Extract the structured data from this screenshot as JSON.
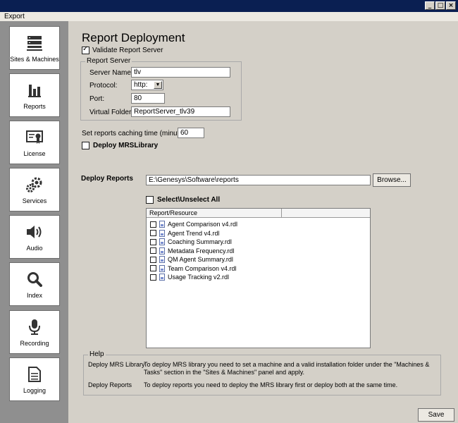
{
  "window": {
    "minimize": "_",
    "maximize": "□",
    "close": "×"
  },
  "menu": {
    "export": "Export"
  },
  "sidebar": {
    "items": [
      {
        "label": "Sites & Machines",
        "icon": "server-icon"
      },
      {
        "label": "Reports",
        "icon": "bar-chart-icon"
      },
      {
        "label": "License",
        "icon": "certificate-icon"
      },
      {
        "label": "Services",
        "icon": "gears-icon"
      },
      {
        "label": "Audio",
        "icon": "speaker-icon"
      },
      {
        "label": "Index",
        "icon": "magnifier-icon"
      },
      {
        "label": "Recording",
        "icon": "microphone-icon"
      },
      {
        "label": "Logging",
        "icon": "document-icon"
      }
    ]
  },
  "main": {
    "title": "Report Deployment",
    "validate_label": "Validate Report Server",
    "validate_checked": true,
    "report_server": {
      "group_title": "Report Server",
      "server_name_label": "Server Name:",
      "server_name_value": "tlv",
      "protocol_label": "Protocol:",
      "protocol_value": "http:",
      "port_label": "Port:",
      "port_value": "80",
      "virtual_folder_label": "Virtual Folder:",
      "virtual_folder_value": "ReportServer_tlv39"
    },
    "caching_label": "Set reports caching time (minutes)",
    "caching_value": "60",
    "deploy_mrs_label": "Deploy MRSLibrary",
    "deploy_reports_label": "Deploy Reports",
    "path_value": "E:\\Genesys\\Software\\reports",
    "browse_label": "Browse...",
    "select_all_label": "Select\\Unselect All",
    "list_header": "Report/Resource",
    "reports": [
      "Agent Comparison v4.rdl",
      "Agent Trend v4.rdl",
      "Coaching Summary.rdl",
      "Metadata Frequency.rdl",
      "QM Agent Summary.rdl",
      "Team Comparison v4.rdl",
      "Usage Tracking v2.rdl"
    ],
    "help": {
      "group_title": "Help",
      "mrs_label": "Deploy MRS Library",
      "mrs_text_1": "To deploy MRS library you need to set a machine and a valid installation folder under the \"Machines &",
      "mrs_text_2": "Tasks\" section in the \"Sites & Machines\" panel and apply.",
      "reports_label": "Deploy Reports",
      "reports_text": "To deploy reports you need to deploy the MRS library first or deploy both at the same time."
    },
    "save_label": "Save"
  }
}
